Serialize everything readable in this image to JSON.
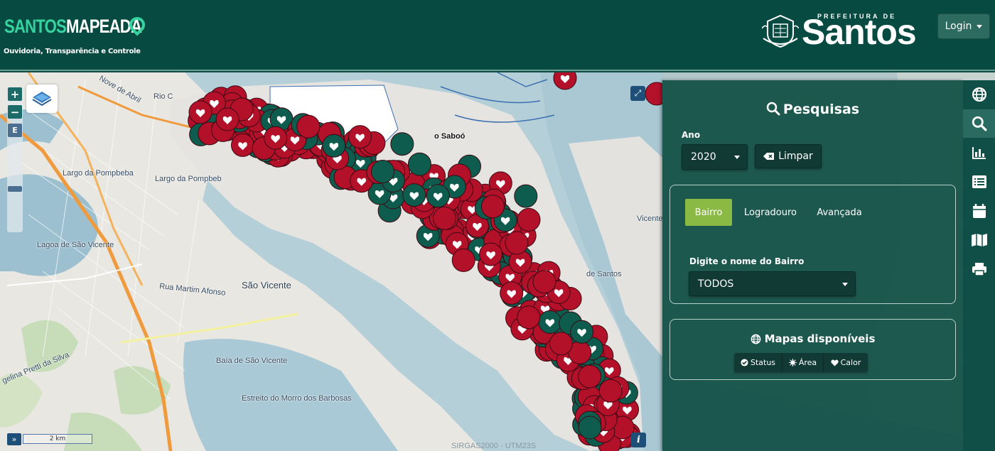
{
  "header": {
    "brand_part1": "SANTOS",
    "brand_part2": "MAPEADA",
    "tagline": "Ouvidoria, Transparência e Controle",
    "prefeitura_small": "PREFEITURA DE",
    "prefeitura_big": "Santos",
    "login_label": "Login"
  },
  "colors": {
    "header_bg": "#074a42",
    "brand_accent": "#36d39f",
    "panel_bg": "#115046",
    "tab_active": "#8ab944",
    "marker_red": "#b3102a",
    "marker_green": "#0e5c4e"
  },
  "map": {
    "labels": [
      "Nove de Abril",
      "Rio C",
      "Largo da Pompbeba",
      "Largo da Pompbeb",
      "Lagoa de São Vicente",
      "São Vicente",
      "Rua Martim Afonso",
      "Baía de São Vicente",
      "Estreito do Morro dos Barbosas",
      "gelina Pretti da Silva",
      "o Saboó",
      "de Santos",
      "Vicente"
    ],
    "scale_label": "2 km",
    "crs_label": "SIRGAS2000 - UTM23S",
    "zoom_in": "+",
    "zoom_out": "−",
    "extent_btn": "E"
  },
  "panel": {
    "title": "Pesquisas",
    "year_label": "Ano",
    "year_value": "2020",
    "clear_label": "Limpar",
    "tabs": [
      {
        "label": "Bairro",
        "active": true
      },
      {
        "label": "Logradouro",
        "active": false
      },
      {
        "label": "Avançada",
        "active": false
      }
    ],
    "bairro_label": "Digite o nome do Bairro",
    "bairro_value": "TODOS",
    "maps_title": "Mapas disponíveis",
    "map_types": [
      "Status",
      "Área",
      "Calor"
    ]
  },
  "sidebar": {
    "icons": [
      "globe-icon",
      "search-icon",
      "bar-chart-icon",
      "list-icon",
      "calendar-icon",
      "map-icon",
      "print-icon"
    ]
  }
}
